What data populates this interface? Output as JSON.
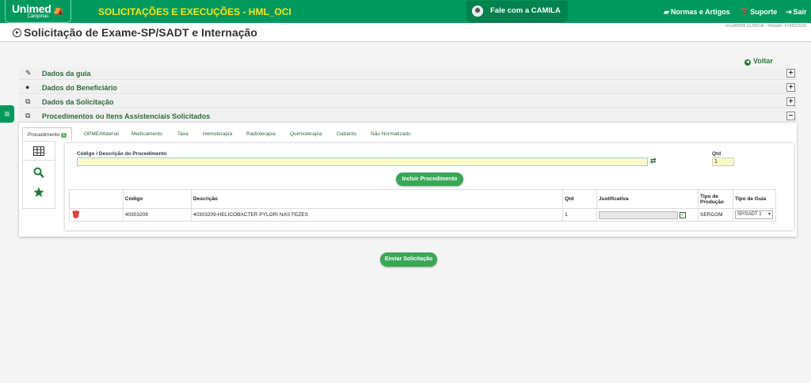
{
  "topbar": {
    "logo_name": "Unimed",
    "logo_sub": "Campinas",
    "app_title": "SOLICITAÇÕES E EXECUÇÕES - HML_OCI",
    "chat_label": "Fale com a CAMILA",
    "links": {
      "normas": "Normas e Artigos",
      "suporte": "Suporte",
      "sair": "Sair"
    }
  },
  "header": {
    "title": "Solicitação de Exame-SP/SADT e Internação",
    "session": "uncpl0058 CLINICA - Sessão: 614501533"
  },
  "voltar": "Voltar",
  "sections": [
    {
      "label": "Dados da guia",
      "icon": "edit-icon",
      "state": "+"
    },
    {
      "label": "Dados do Beneficiário",
      "icon": "user-icon",
      "state": "+"
    },
    {
      "label": "Dados da Solicitação",
      "icon": "copy-icon",
      "state": "+"
    },
    {
      "label": "Procedimentos ou Itens Assistenciais Solicitados",
      "icon": "copy-icon",
      "state": "−"
    }
  ],
  "tabs": [
    {
      "label": "Procedimento",
      "badge": "1"
    },
    {
      "label": "OPME/Material"
    },
    {
      "label": "Medicamento"
    },
    {
      "label": "Taxa"
    },
    {
      "label": "Hemoterapia"
    },
    {
      "label": "Radioterapia"
    },
    {
      "label": "Quimioterapia"
    },
    {
      "label": "Gabarito"
    },
    {
      "label": "Não Normatizado"
    }
  ],
  "form": {
    "proc_label": "Código / Descrição do Procedimento",
    "proc_value": "",
    "qtd_label": "Qtd",
    "qtd_value": "1",
    "include_button": "Incluir Procedimento"
  },
  "table": {
    "headers": [
      "Código",
      "Descrição",
      "Qtd",
      "Justificativa",
      "Tipo de Produção",
      "Tipo de Guia"
    ],
    "rows": [
      {
        "codigo": "40303209",
        "descricao": "40303209-HELICOBACTER PYLORI NAS FEZES",
        "qtd": "1",
        "justificativa": "",
        "tipo_producao": "SERCOM",
        "tipo_guia": "SP/SADT 1"
      }
    ]
  },
  "submit_button": "Enviar Solicitação",
  "colors": {
    "brand": "#00995d",
    "title_yellow": "#f5e51b",
    "button": "#3aa757"
  }
}
